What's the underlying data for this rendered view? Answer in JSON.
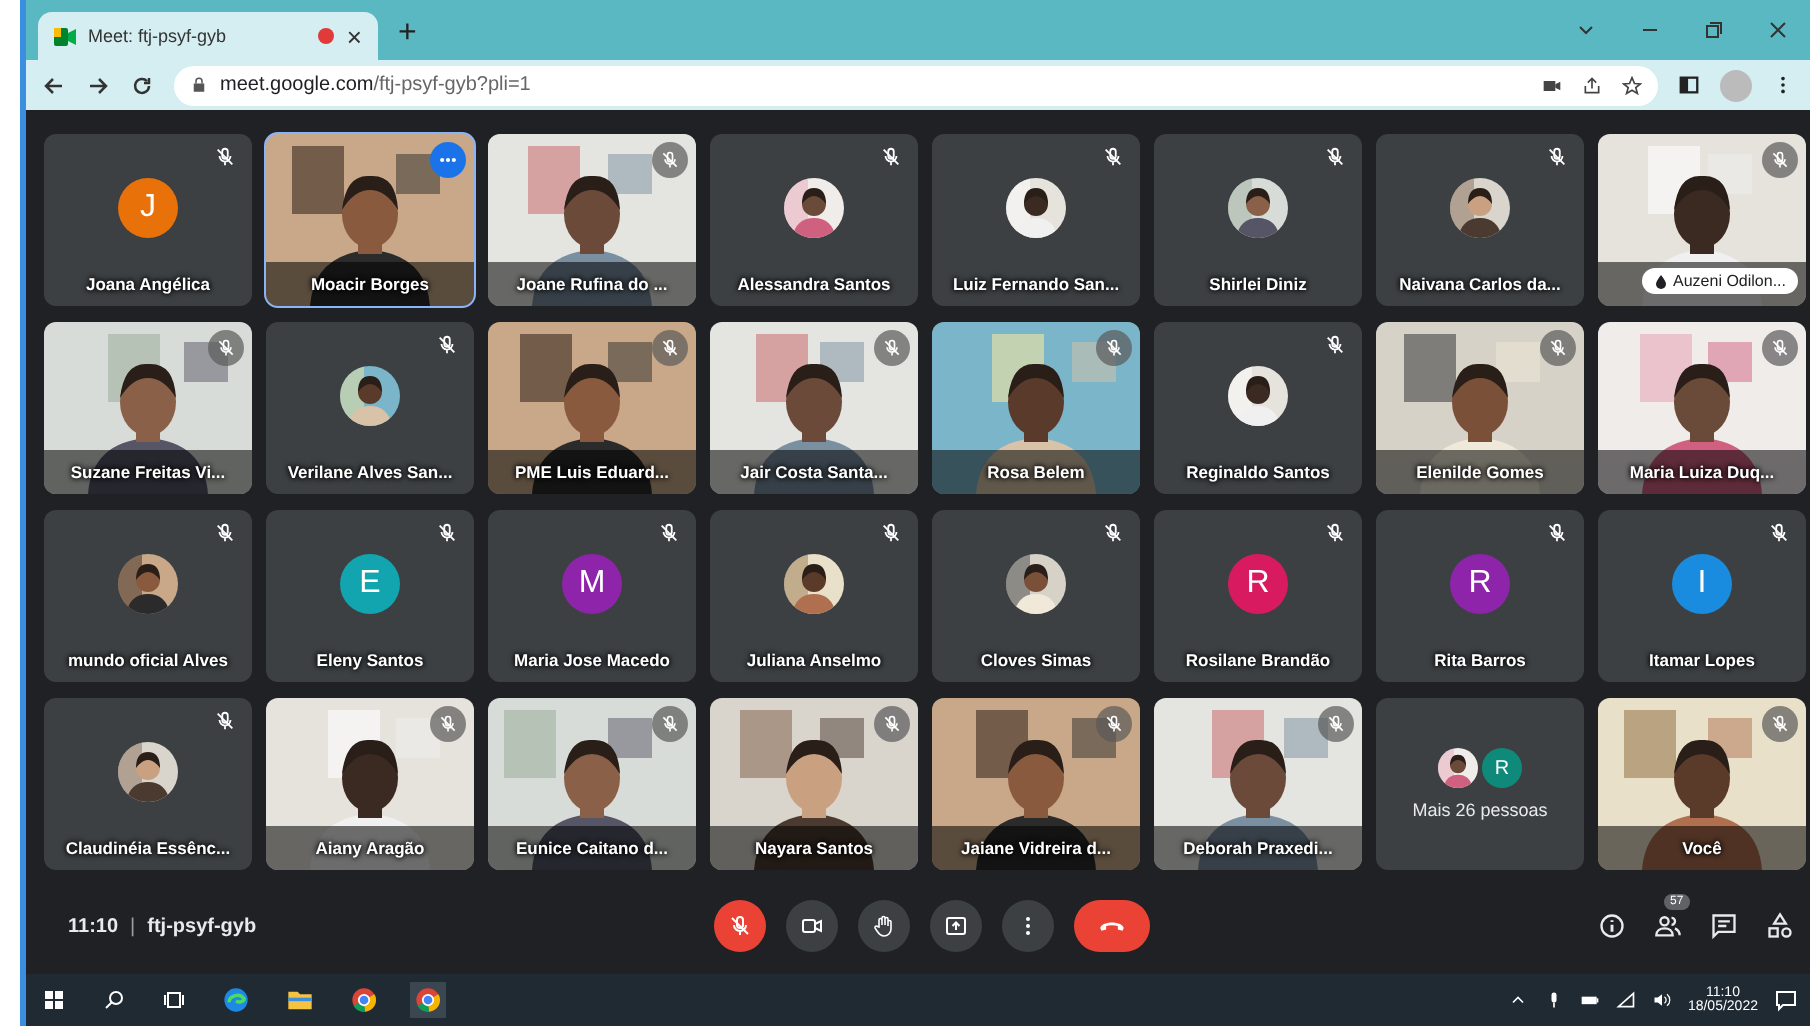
{
  "browser": {
    "tab": {
      "title": "Meet: ftj-psyf-gyb",
      "recording": true,
      "close": "×"
    },
    "new_tab": "+",
    "address": {
      "domain": "meet.google.com",
      "path": "/ftj-psyf-gyb?pli=1"
    }
  },
  "tiles": [
    {
      "name": "Joana Angélica",
      "kind": "letter",
      "letter": "J",
      "color": "#e8710a",
      "muted": true,
      "selected": false
    },
    {
      "name": "Moacir Borges",
      "kind": "video",
      "muted": false,
      "selected": true
    },
    {
      "name": "Joane Rufina do ...",
      "kind": "video",
      "muted": true,
      "selected": false
    },
    {
      "name": "Alessandra Santos",
      "muted": true,
      "selected": false
    },
    {
      "name": "Luiz Fernando San...",
      "muted": true,
      "selected": false
    },
    {
      "name": "Shirlei Diniz",
      "muted": true,
      "selected": false
    },
    {
      "name": "Naivana Carlos da...",
      "muted": true,
      "selected": false
    },
    {
      "name": "Auzeni Odilon...",
      "kind": "pinned",
      "muted": true,
      "selected": false
    },
    {
      "name": "Suzane Freitas Vi...",
      "kind": "video",
      "muted": true,
      "selected": false
    },
    {
      "name": "Verilane Alves San...",
      "muted": true,
      "selected": false
    },
    {
      "name": "PME Luis Eduard...",
      "kind": "video",
      "muted": true,
      "selected": false
    },
    {
      "name": "Jair Costa Santa...",
      "kind": "video",
      "muted": true,
      "selected": false
    },
    {
      "name": "Rosa Belem",
      "kind": "video",
      "muted": true,
      "selected": false
    },
    {
      "name": "Reginaldo Santos",
      "muted": true,
      "selected": false
    },
    {
      "name": "Elenilde Gomes",
      "kind": "video",
      "muted": true,
      "selected": false
    },
    {
      "name": "Maria Luiza Duq...",
      "kind": "video",
      "muted": true,
      "selected": false
    },
    {
      "name": "mundo oficial Alves",
      "muted": true,
      "selected": false
    },
    {
      "name": "Eleny Santos",
      "kind": "letter",
      "letter": "E",
      "color": "#12a4af",
      "muted": true,
      "selected": false
    },
    {
      "name": "Maria Jose Macedo",
      "kind": "letter",
      "letter": "M",
      "color": "#8e24aa",
      "muted": true,
      "selected": false
    },
    {
      "name": "Juliana Anselmo",
      "muted": true,
      "selected": false
    },
    {
      "name": "Cloves Simas",
      "muted": true,
      "selected": false
    },
    {
      "name": "Rosilane Brandão",
      "kind": "letter",
      "letter": "R",
      "color": "#d81b60",
      "muted": true,
      "selected": false
    },
    {
      "name": "Rita Barros",
      "kind": "letter",
      "letter": "R",
      "color": "#8e24aa",
      "muted": true,
      "selected": false
    },
    {
      "name": "Itamar Lopes",
      "kind": "letter",
      "letter": "I",
      "color": "#1a8ce0",
      "muted": true,
      "selected": false
    },
    {
      "name": "Claudinéia Essênc...",
      "muted": true,
      "selected": false
    },
    {
      "name": "Aiany Aragão",
      "kind": "video",
      "muted": true,
      "selected": false
    },
    {
      "name": "Eunice Caitano d...",
      "kind": "video",
      "muted": true,
      "selected": false
    },
    {
      "name": "Nayara Santos",
      "kind": "video",
      "muted": true,
      "selected": false
    },
    {
      "name": "Jaiane Vidreira d...",
      "kind": "video",
      "muted": true,
      "selected": false
    },
    {
      "name": "Deborah Praxedi...",
      "kind": "video",
      "muted": true,
      "selected": false
    },
    {
      "name": "Mais 26 pessoas",
      "kind": "overflow",
      "letter": "R",
      "color": "#0f8a7a",
      "muted": false,
      "selected": false
    },
    {
      "name": "Você",
      "kind": "video",
      "muted": true,
      "selected": false
    }
  ],
  "meeting": {
    "time": "11:10",
    "separator": "|",
    "code": "ftj-psyf-gyb",
    "mic_on": false,
    "people_count": "57"
  },
  "taskbar": {
    "time": "11:10",
    "date": "18/05/2022"
  }
}
